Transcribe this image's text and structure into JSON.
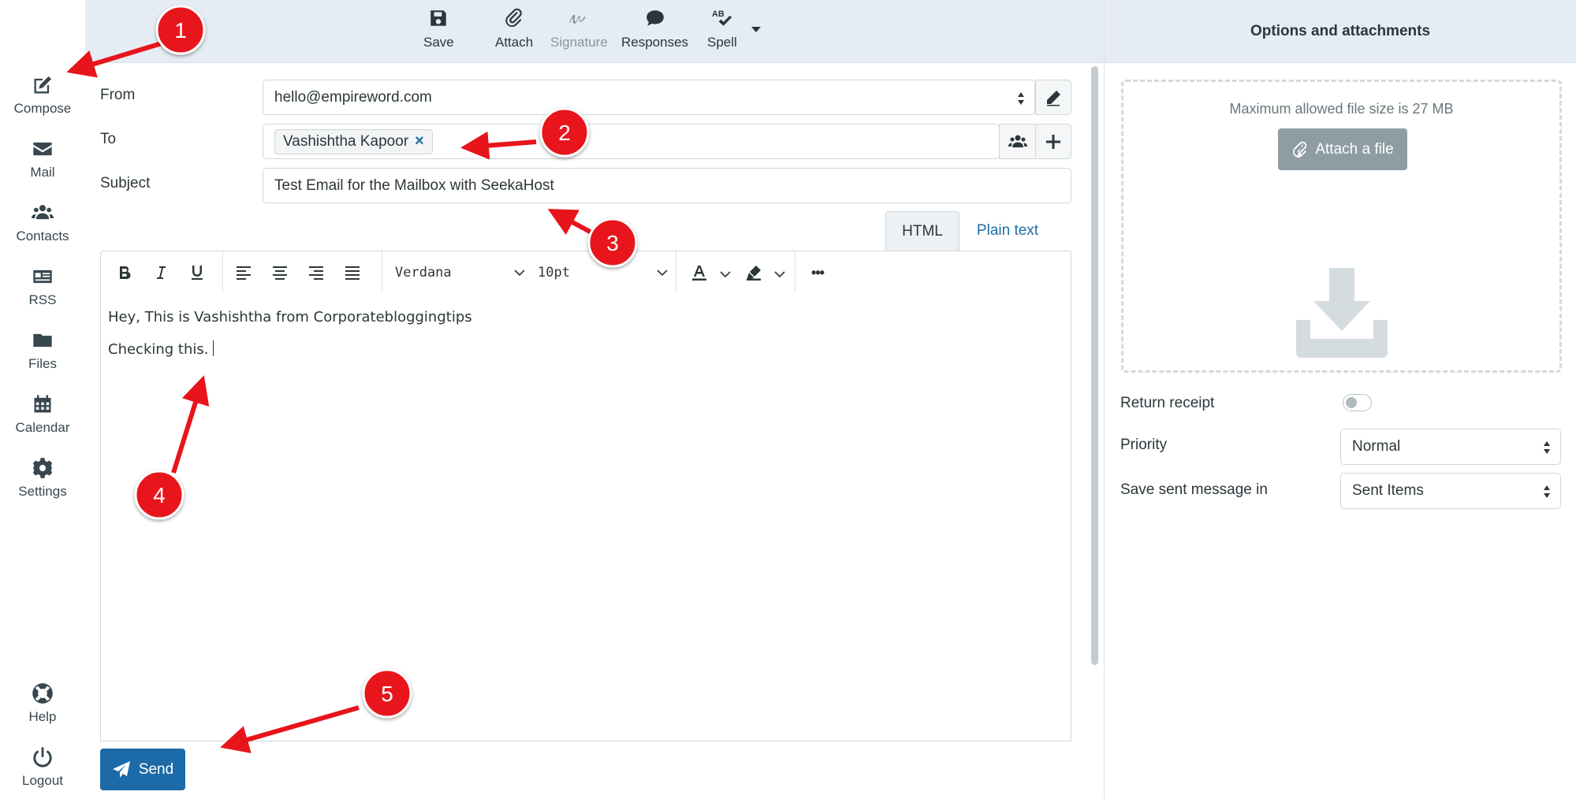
{
  "nav": {
    "items": [
      {
        "label": "Compose",
        "icon": "compose-icon"
      },
      {
        "label": "Mail",
        "icon": "mail-icon"
      },
      {
        "label": "Contacts",
        "icon": "contacts-icon"
      },
      {
        "label": "RSS",
        "icon": "rss-icon"
      },
      {
        "label": "Files",
        "icon": "folder-icon"
      },
      {
        "label": "Calendar",
        "icon": "calendar-icon"
      },
      {
        "label": "Settings",
        "icon": "gear-icon"
      }
    ],
    "bottom": [
      {
        "label": "Help",
        "icon": "lifebuoy-icon"
      },
      {
        "label": "Logout",
        "icon": "power-icon"
      }
    ]
  },
  "toolbar": {
    "save": "Save",
    "attach": "Attach",
    "signature": "Signature",
    "responses": "Responses",
    "spell": "Spell"
  },
  "form": {
    "from_label": "From",
    "from_value": "hello@empireword.com",
    "to_label": "To",
    "recipient": "Vashishtha Kapoor",
    "recipient_remove": "×",
    "subject_label": "Subject",
    "subject_value": "Test Email for the Mailbox with SeekaHost"
  },
  "editor": {
    "tabs": {
      "html": "HTML",
      "plain": "Plain text"
    },
    "active_tab": "HTML",
    "font": "Verdana",
    "size": "10pt",
    "more": "•••",
    "lines": [
      "Hey, This is Vashishtha from Corporatebloggingtips",
      "Checking this."
    ]
  },
  "send_label": "Send",
  "sidepanel": {
    "title": "Options and attachments",
    "max_size": "Maximum allowed file size is 27 MB",
    "attach_button": "Attach a file",
    "return_receipt_label": "Return receipt",
    "return_receipt_on": false,
    "priority_label": "Priority",
    "priority_value": "Normal",
    "save_in_label": "Save sent message in",
    "save_in_value": "Sent Items"
  },
  "callouts": [
    "1",
    "2",
    "3",
    "4",
    "5"
  ],
  "colors": {
    "accent": "#1c6aa8",
    "callout": "#e8141b",
    "toolbar_bg": "#e6ecf3"
  }
}
